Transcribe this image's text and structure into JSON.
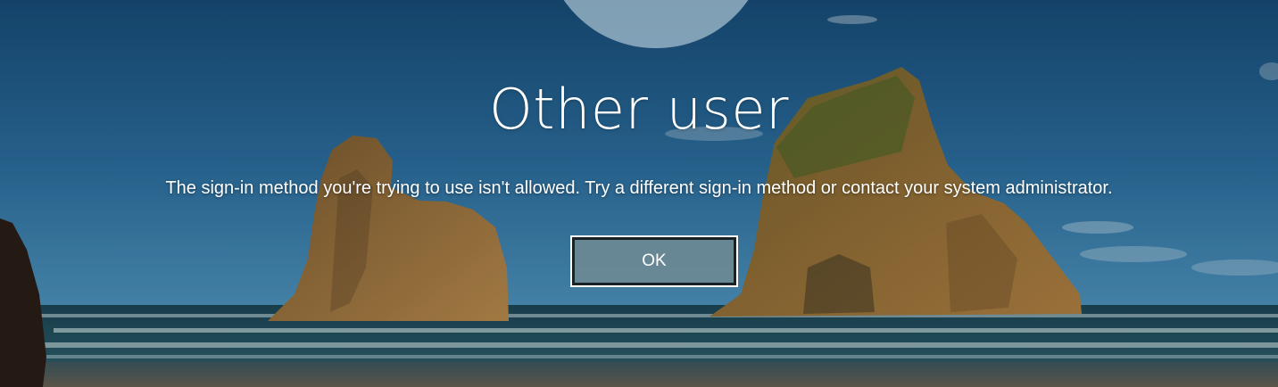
{
  "lock_screen": {
    "user_name": "Other user",
    "error_message": "The sign-in method you're trying to use isn't allowed. Try a different sign-in method or contact your system administrator.",
    "ok_label": "OK"
  },
  "background": {
    "description_icon": "beach-rocks-wallpaper",
    "colors": {
      "sky_top": "#1d5784",
      "sky_bottom": "#3f87b3",
      "sea": "#1f4e5e",
      "rock": "#9a6e35"
    }
  }
}
